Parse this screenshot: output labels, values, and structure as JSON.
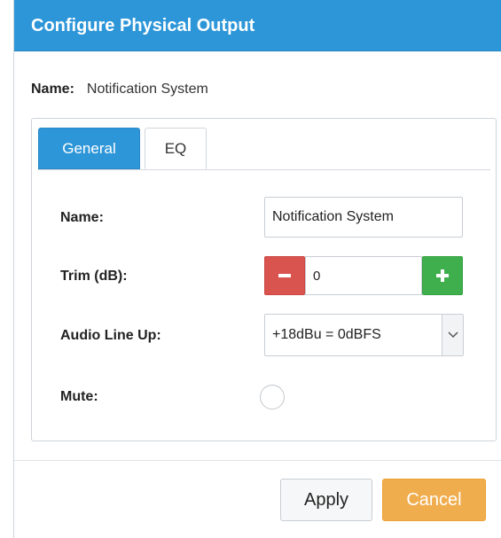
{
  "dialog": {
    "title": "Configure Physical Output",
    "name_label": "Name:",
    "name_value": "Notification System"
  },
  "tabs": [
    {
      "label": "General",
      "active": true
    },
    {
      "label": "EQ",
      "active": false
    }
  ],
  "form": {
    "name_label": "Name:",
    "name_value": "Notification System",
    "trim_label": "Trim (dB):",
    "trim_value": "0",
    "lineup_label": "Audio Line Up:",
    "lineup_value": "+18dBu = 0dBFS",
    "mute_label": "Mute:",
    "mute_checked": false
  },
  "buttons": {
    "apply": "Apply",
    "cancel": "Cancel"
  },
  "colors": {
    "header": "#2d96d8",
    "minus": "#d9534f",
    "plus": "#3fae4c",
    "cancel": "#f0ad4e"
  },
  "icons": {
    "minus": "minus-icon",
    "plus": "plus-icon",
    "dropdown": "chevron-down-icon"
  }
}
